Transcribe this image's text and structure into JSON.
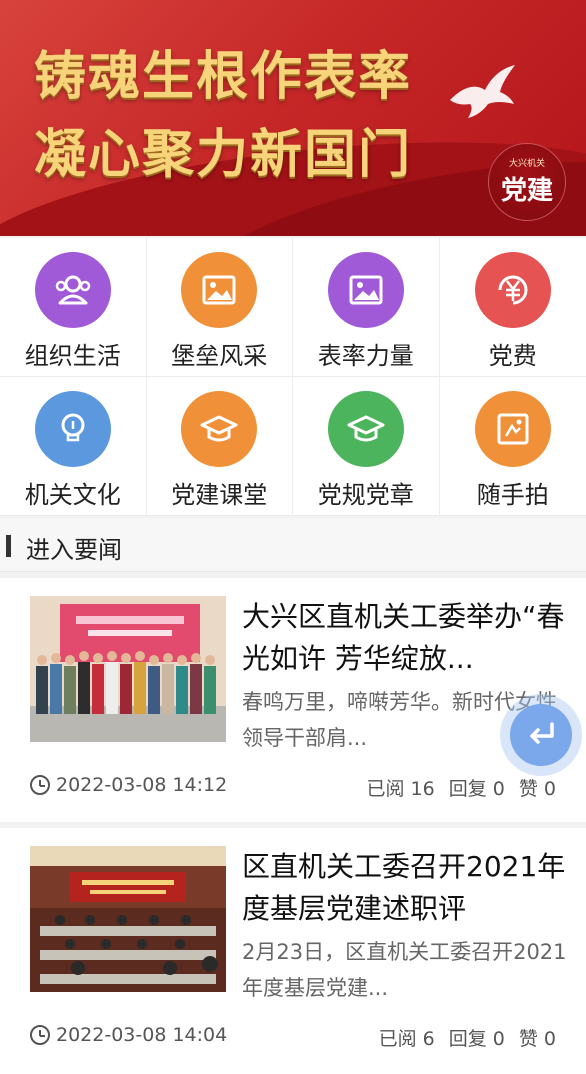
{
  "banner": {
    "line1": "铸魂生根作表率",
    "line2": "凝心聚力新国门",
    "emblem_small": "大兴机关",
    "emblem_big": "党建",
    "emblem_tiny": ""
  },
  "grid": [
    {
      "label": "组织生活",
      "icon": "people-icon",
      "color": "#a05ad8"
    },
    {
      "label": "堡垒风采",
      "icon": "image-icon",
      "color": "#f0913a"
    },
    {
      "label": "表率力量",
      "icon": "image-icon",
      "color": "#a05ad8"
    },
    {
      "label": "党费",
      "icon": "yen-icon",
      "color": "#e65353"
    },
    {
      "label": "机关文化",
      "icon": "bulb-icon",
      "color": "#5b98dd"
    },
    {
      "label": "党建课堂",
      "icon": "graduation-cap-icon",
      "color": "#f0913a"
    },
    {
      "label": "党规党章",
      "icon": "graduation-cap-icon",
      "color": "#4cb45c"
    },
    {
      "label": "随手拍",
      "icon": "photo-frame-icon",
      "color": "#f0913a"
    }
  ],
  "section": {
    "title": "进入要闻"
  },
  "news": [
    {
      "headline": "大兴区直机关工委举办“春光如许 芳华绽放...",
      "summary": "春鸣万里，啼啭芳华。新时代女性领导干部肩...",
      "time": "2022-03-08 14:12",
      "reads": "已阅 16",
      "replies": "回复 0",
      "likes": "赞 0"
    },
    {
      "headline": "区直机关工委召开2021年度基层党建述职评",
      "summary": "2月23日，区直机关工委召开2021年度基层党建...",
      "time": "2022-03-08 14:04",
      "reads": "已阅 6",
      "replies": "回复 0",
      "likes": "赞 0"
    }
  ],
  "fab": {
    "icon": "return-arrow-icon",
    "color": "#7aa8ea"
  }
}
